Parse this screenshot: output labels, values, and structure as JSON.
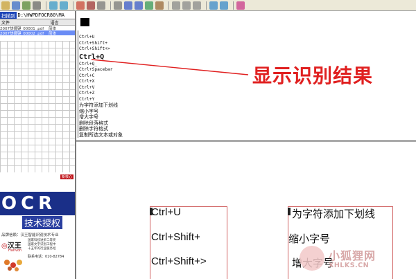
{
  "toolbar": {
    "icons": [
      "open-icon",
      "save-icon",
      "scan-icon",
      "page-icon",
      "zoom-in-icon",
      "zoom-out-icon",
      "erase-icon",
      "eraser-icon",
      "analyze-icon",
      "copy-icon",
      "layout-grid-icon",
      "table-icon",
      "image-region-icon",
      "text-region-icon",
      "select-icon",
      "rect-select-icon",
      "pen-icon",
      "prev-icon",
      "next-icon",
      "color-icon"
    ]
  },
  "left_panel": {
    "scan_button": "扫描到",
    "path": "D:\\HWPDFOCR80\\MA",
    "columns": [
      "文件",
      "语言"
    ],
    "files": [
      {
        "name": "2007快捷键_00001 .pdf",
        "lang": "简体"
      },
      {
        "name": "2007快捷键_00002 .pdf",
        "lang": "简体"
      }
    ],
    "ad": {
      "new_tag": "新核心",
      "ocr_text": "OCR",
      "tech_text": "技术授权",
      "brand_line": "品牌信赖：汉王智能识别技术专业",
      "logo_cn": "汉王",
      "logo_en": "Hanvon",
      "desc": [
        "国家科技进步二等奖",
        "国家文字识别工程中",
        "十五年的行业服务经"
      ],
      "tel": "联系电话：010-82784"
    }
  },
  "result": {
    "lines_top": [
      "Ctrl+U",
      "Ctrl+Shift+",
      "Ctrl+Shift+>"
    ],
    "highlight": "Ctrl+Q",
    "lines_mid": [
      "Ctrl+Q_",
      "Ctrl+Spacebar",
      "Ctrl+C",
      "Ctrl+X",
      "Ctrl+V",
      "Ctrl+Z",
      "Ctrl+Y"
    ],
    "lines_cn": [
      "为字符添加下划线",
      "缩小字号",
      "增大字号",
      "删除段落格式",
      "删除字符格式",
      "复制所选文本或对象"
    ],
    "annotation": "显示识别结果"
  },
  "preview": {
    "left_lines": [
      "Ctrl+U",
      "Ctrl+Shift+",
      "Ctrl+Shift+>"
    ],
    "right_lines": [
      "为字符添加下划线",
      "缩小字号",
      "增大字号"
    ]
  },
  "watermark": {
    "title": "小狐狸网",
    "domain": "XHLKS.CN"
  }
}
